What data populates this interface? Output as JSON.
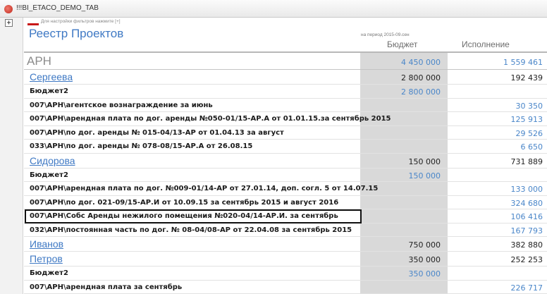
{
  "window": {
    "tab_title": "!!!BI_ETACO_DEMO_TAB",
    "tab_icon": "app-icon"
  },
  "toolbar": {
    "expand_label": "+"
  },
  "filter": {
    "hint": "Для настройки фильтров нажмите [+]",
    "arrow_icon": "arrow-left-icon"
  },
  "report": {
    "title": "Реестр Проектов",
    "period": "на период  2015-09.сен",
    "columns": {
      "budget": "Бюджет",
      "execution": "Исполнение"
    }
  },
  "colors": {
    "link": "#3f79c4",
    "value_blue": "#4a86c9",
    "budget_column_bg": "#d9d9d9"
  },
  "rows": [
    {
      "kind": "top",
      "label": "АРН",
      "budget": "4 450 000",
      "budget_blue": true,
      "execution": "1 559 461",
      "execution_blue": true
    },
    {
      "kind": "person",
      "label": "Сергеева",
      "budget": "2 800 000",
      "execution": "192 439"
    },
    {
      "kind": "item",
      "label": "Бюджет2",
      "budget": "2 800 000",
      "budget_blue": true,
      "execution": ""
    },
    {
      "kind": "item",
      "label": "007\\АРН\\агентское вознаграждение за июнь",
      "budget": "",
      "execution": "30 350",
      "execution_blue": true
    },
    {
      "kind": "item",
      "label": "007\\АРН\\арендная плата по дог. аренды №050-01/15-АР.А от 01.01.15.за сентябрь 2015",
      "budget": "",
      "execution": "125 913",
      "execution_blue": true
    },
    {
      "kind": "item",
      "label": "007\\АРН\\по дог. аренды № 015-04/13-АР от 01.04.13 за август",
      "budget": "",
      "execution": "29 526",
      "execution_blue": true
    },
    {
      "kind": "item",
      "label": "033\\АРН\\по дог. аренды № 078-08/15-АР.А от 26.08.15",
      "budget": "",
      "execution": "6 650",
      "execution_blue": true
    },
    {
      "kind": "person",
      "label": "Сидорова",
      "budget": "150 000",
      "execution": "731 889"
    },
    {
      "kind": "item",
      "label": "Бюджет2",
      "budget": "150 000",
      "budget_blue": true,
      "execution": ""
    },
    {
      "kind": "item",
      "label": "007\\АРН\\арендная плата по дог. №009-01/14-АР от 27.01.14, доп. согл. 5 от 14.07.15",
      "budget": "",
      "execution": "133 000",
      "execution_blue": true
    },
    {
      "kind": "item",
      "label": "007\\АРН\\по дог. 021-09/15-АР.И от 10.09.15 за сентябрь 2015 и август 2016",
      "budget": "",
      "execution": "324 680",
      "execution_blue": true
    },
    {
      "kind": "item",
      "label": "007\\АРН\\Собс Аренды нежилого помещения №020-04/14-АР.И. за сентябрь",
      "budget": "",
      "execution": "106 416",
      "execution_blue": true,
      "selected": true
    },
    {
      "kind": "item",
      "label": "032\\АРН\\постоянная часть по дог. № 08-04/08-АР от 22.04.08 за сентябрь 2015",
      "budget": "",
      "execution": "167 793",
      "execution_blue": true
    },
    {
      "kind": "person",
      "label": "Иванов",
      "budget": "750 000",
      "execution": "382 880"
    },
    {
      "kind": "person",
      "label": "Петров",
      "budget": "350 000",
      "execution": "252 253"
    },
    {
      "kind": "item",
      "label": "Бюджет2",
      "budget": "350 000",
      "budget_blue": true,
      "execution": ""
    },
    {
      "kind": "item",
      "label": "007\\АРН\\арендная плата за сентябрь",
      "budget": "",
      "execution": "226 717",
      "execution_blue": true
    }
  ]
}
